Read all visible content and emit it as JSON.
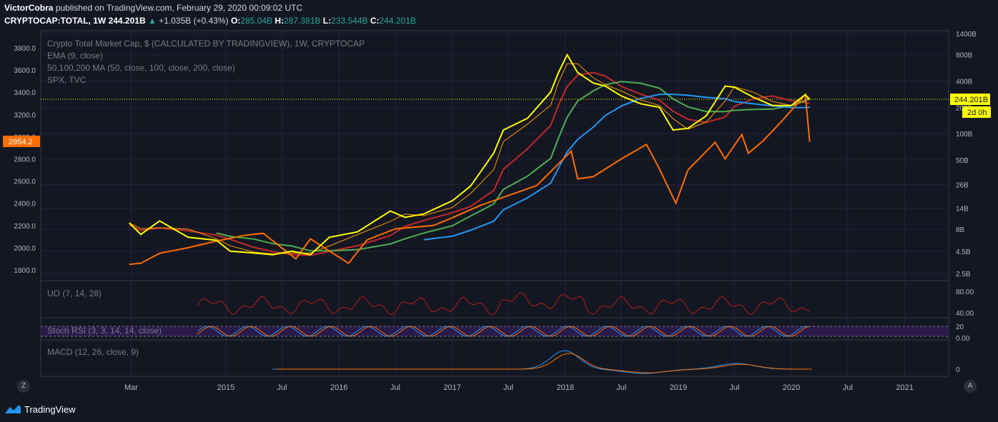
{
  "header": {
    "author": "VictorCobra",
    "publish_text": "published on TradingView.com, February 29, 2020 00:09:02 UTC",
    "symbol": "CRYPTOCAP:TOTAL, 1W",
    "last": "244.201B",
    "change": "+1.035B (+0.43%)",
    "o_label": "O:",
    "o_val": "285.04B",
    "h_label": "H:",
    "h_val": "287.381B",
    "l_label": "L:",
    "l_val": "233.544B",
    "c_label": "C:",
    "c_val": "244.201B"
  },
  "legend": {
    "title": "Crypto Total Market Cap, $ (CALCULATED BY TRADINGVIEW), 1W, CRYPTOCAP",
    "ema": "EMA (9, close)",
    "ma": "50,100,200 MA (50, close, 100, close, 200, close)",
    "spx": "SPX, TVC"
  },
  "labels": {
    "price_tag": "244.201B",
    "countdown": "2d 0h",
    "spx_tag": "2954.2",
    "uo": "UO (7, 14, 28)",
    "stoch": "Stoch RSI (3, 3, 14, 14, close)",
    "macd": "MACD (12, 26, close, 9)",
    "z_button": "Z",
    "a_button": "A"
  },
  "footer": {
    "brand": "TradingView"
  },
  "colors": {
    "background": "#131722",
    "grid": "#2a1f3d",
    "price": "#ffff00",
    "spx": "#ff6d00",
    "ema": "#ff9800",
    "ma50": "#c62828",
    "ma100": "#4caf50",
    "ma200": "#2196f3",
    "uo": "#b71c1c",
    "stoch_k": "#2196f3",
    "stoch_d": "#ff6d00",
    "macd": "#2196f3",
    "signal": "#ff6d00"
  },
  "chart_data": {
    "type": "line",
    "title": "Crypto Total Market Cap, $ (CALCULATED BY TRADINGVIEW), 1W, CRYPTOCAP",
    "log_scale": true,
    "grid": true,
    "x_tick_labels": [
      "Mar",
      "2015",
      "Jul",
      "2016",
      "Jul",
      "2017",
      "Jul",
      "2018",
      "Jul",
      "2019",
      "Jul",
      "2020",
      "Jul",
      "2021"
    ],
    "x_tick_dates": [
      "2014-03-01",
      "2015-01-01",
      "2015-07-01",
      "2016-01-01",
      "2016-07-01",
      "2017-01-01",
      "2017-07-01",
      "2018-01-01",
      "2018-07-01",
      "2019-01-01",
      "2019-07-01",
      "2020-01-01",
      "2020-07-01",
      "2021-01-01"
    ],
    "right_axis_labels": [
      "1400B",
      "800B",
      "400B",
      "200B",
      "100B",
      "50B",
      "26B",
      "14B",
      "8B",
      "4.5B",
      "2.5B"
    ],
    "right_axis_values": [
      1400,
      800,
      400,
      200,
      100,
      50,
      26,
      14,
      8,
      4.5,
      2.5
    ],
    "left_axis_labels": [
      "3800.0",
      "3600.0",
      "3400.0",
      "3200.0",
      "3000.0",
      "2800.0",
      "2600.0",
      "2400.0",
      "2200.0",
      "2000.0",
      "1800.0"
    ],
    "left_axis_values": [
      3800,
      3600,
      3400,
      3200,
      3000,
      2800,
      2600,
      2400,
      2200,
      2000,
      1800
    ],
    "series": [
      {
        "name": "CRYPTOCAP:TOTAL",
        "axis": "right",
        "unit": "B USD",
        "x": [
          "2014-02-23",
          "2014-04-01",
          "2014-06-01",
          "2014-09-01",
          "2014-12-01",
          "2015-01-15",
          "2015-04-01",
          "2015-06-01",
          "2015-08-01",
          "2015-10-01",
          "2015-12-01",
          "2016-03-01",
          "2016-06-15",
          "2016-08-01",
          "2016-10-01",
          "2017-01-01",
          "2017-03-01",
          "2017-05-15",
          "2017-06-15",
          "2017-09-01",
          "2017-11-15",
          "2017-12-10",
          "2018-01-07",
          "2018-02-10",
          "2018-04-01",
          "2018-05-10",
          "2018-07-01",
          "2018-09-01",
          "2018-11-01",
          "2018-12-15",
          "2019-02-01",
          "2019-04-01",
          "2019-06-01",
          "2019-07-01",
          "2019-09-01",
          "2019-11-01",
          "2020-01-01",
          "2020-02-15",
          "2020-02-29"
        ],
        "y": [
          9.5,
          7,
          10,
          6.5,
          6,
          4.5,
          4.3,
          4.1,
          4.5,
          4.1,
          6.5,
          7.5,
          13,
          11,
          12,
          17,
          25,
          60,
          110,
          150,
          300,
          500,
          800,
          500,
          380,
          350,
          270,
          220,
          200,
          110,
          115,
          160,
          350,
          340,
          260,
          210,
          210,
          280,
          244.201
        ]
      },
      {
        "name": "SPX",
        "axis": "left",
        "unit": "index",
        "x": [
          "2014-02-23",
          "2014-04-01",
          "2014-06-01",
          "2014-09-01",
          "2014-12-01",
          "2015-03-01",
          "2015-05-01",
          "2015-08-15",
          "2015-10-01",
          "2016-02-01",
          "2016-04-01",
          "2016-07-01",
          "2016-11-01",
          "2017-01-01",
          "2017-04-01",
          "2017-07-01",
          "2017-10-01",
          "2018-01-20",
          "2018-02-10",
          "2018-04-01",
          "2018-07-01",
          "2018-09-20",
          "2018-10-30",
          "2018-12-24",
          "2019-02-01",
          "2019-04-30",
          "2019-06-01",
          "2019-07-25",
          "2019-08-15",
          "2019-10-01",
          "2019-12-01",
          "2020-02-15",
          "2020-02-29"
        ],
        "y": [
          1850,
          1860,
          1950,
          2000,
          2060,
          2110,
          2130,
          1900,
          2080,
          1860,
          2070,
          2170,
          2200,
          2270,
          2380,
          2470,
          2560,
          2870,
          2620,
          2640,
          2800,
          2930,
          2720,
          2400,
          2700,
          2950,
          2800,
          3020,
          2850,
          2960,
          3140,
          3380,
          2954.2
        ]
      }
    ],
    "indicators": [
      {
        "name": "EMA (9, close)"
      },
      {
        "name": "50,100,200 MA (50, close, 100, close, 200, close)"
      },
      {
        "name": "UO (7, 14, 28)",
        "axis_labels": [
          "80.00",
          "40.00"
        ]
      },
      {
        "name": "Stoch RSI (3, 3, 14, 14, close)",
        "axis_labels": [
          "20",
          "0.00"
        ]
      },
      {
        "name": "MACD (12, 26, close, 9)",
        "axis_labels": [
          "0"
        ]
      }
    ]
  }
}
